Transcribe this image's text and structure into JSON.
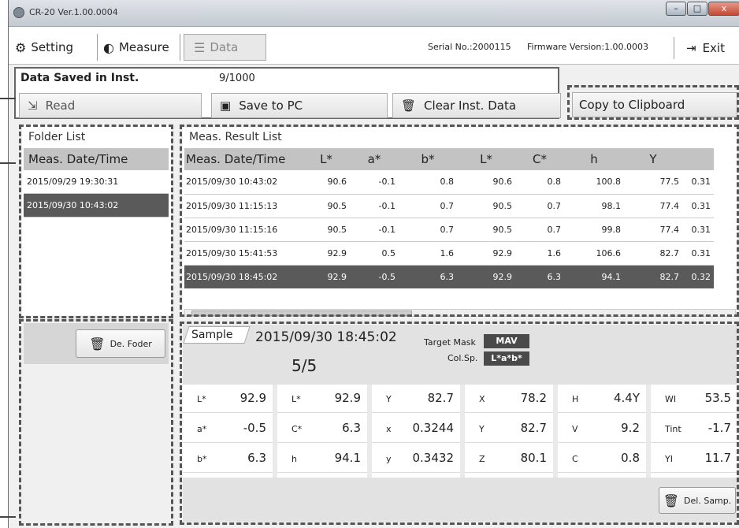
{
  "window": {
    "title": "CR-20 Ver.1.00.0004",
    "controls": [
      "–",
      "□",
      "x"
    ]
  },
  "toolbar": {
    "setting_label": "Setting",
    "measure_label": "Measure",
    "data_label": "Data",
    "serial": "Serial No.:2000115",
    "firmware": "Firmware Version:1.00.0003",
    "exit_label": "Exit"
  },
  "saved": {
    "label": "Data Saved in Inst.",
    "count": "9/1000",
    "read_label": "Read",
    "save_label": "Save to PC",
    "clear_label": "Clear Inst. Data",
    "copy_label": "Copy to Clipboard"
  },
  "folder": {
    "title": "Folder List",
    "header": "Meas. Date/Time",
    "rows": [
      "2015/09/29 19:30:31",
      "2015/09/30 10:43:02"
    ],
    "selected_index": 1,
    "delete_label": "De. Foder"
  },
  "results": {
    "title": "Meas. Result List",
    "headers": [
      "Meas. Date/Time",
      "L*",
      "a*",
      "b*",
      "L*",
      "C*",
      "h",
      "Y",
      ""
    ],
    "rows": [
      [
        "2015/09/30 10:43:02",
        "90.6",
        "-0.1",
        "0.8",
        "90.6",
        "0.8",
        "100.8",
        "77.5",
        "0.31"
      ],
      [
        "2015/09/30 11:15:13",
        "90.5",
        "-0.1",
        "0.7",
        "90.5",
        "0.7",
        "98.1",
        "77.4",
        "0.31"
      ],
      [
        "2015/09/30 11:15:16",
        "90.5",
        "-0.1",
        "0.7",
        "90.5",
        "0.7",
        "99.8",
        "77.4",
        "0.31"
      ],
      [
        "2015/09/30 15:41:53",
        "92.9",
        "0.5",
        "1.6",
        "92.9",
        "1.6",
        "106.6",
        "82.7",
        "0.31"
      ],
      [
        "2015/09/30 18:45:02",
        "92.9",
        "-0.5",
        "6.3",
        "92.9",
        "6.3",
        "94.1",
        "82.7",
        "0.32"
      ]
    ],
    "selected_index": 4
  },
  "sample": {
    "tag": "Sample",
    "date": "2015/09/30 18:45:02",
    "count": "5/5",
    "mask_label": "Target Mask",
    "mask_value": "MAV",
    "colsp_label": "Col.Sp.",
    "colsp_value": "L*a*b*",
    "cells": [
      [
        {
          "l": "L*",
          "v": "92.9"
        },
        {
          "l": "a*",
          "v": "-0.5"
        },
        {
          "l": "b*",
          "v": "6.3"
        }
      ],
      [
        {
          "l": "L*",
          "v": "92.9"
        },
        {
          "l": "C*",
          "v": "6.3"
        },
        {
          "l": "h",
          "v": "94.1"
        }
      ],
      [
        {
          "l": "Y",
          "v": "82.7"
        },
        {
          "l": "x",
          "v": "0.3244"
        },
        {
          "l": "y",
          "v": "0.3432"
        }
      ],
      [
        {
          "l": "X",
          "v": "78.2"
        },
        {
          "l": "Y",
          "v": "82.7"
        },
        {
          "l": "Z",
          "v": "80.1"
        }
      ],
      [
        {
          "l": "H",
          "v": "4.4Y"
        },
        {
          "l": "V",
          "v": "9.2"
        },
        {
          "l": "C",
          "v": "0.8"
        }
      ],
      [
        {
          "l": "WI",
          "v": "53.5"
        },
        {
          "l": "Tint",
          "v": "-1.7"
        },
        {
          "l": "YI",
          "v": "11.7"
        }
      ]
    ],
    "delete_label": "Del. Samp."
  }
}
